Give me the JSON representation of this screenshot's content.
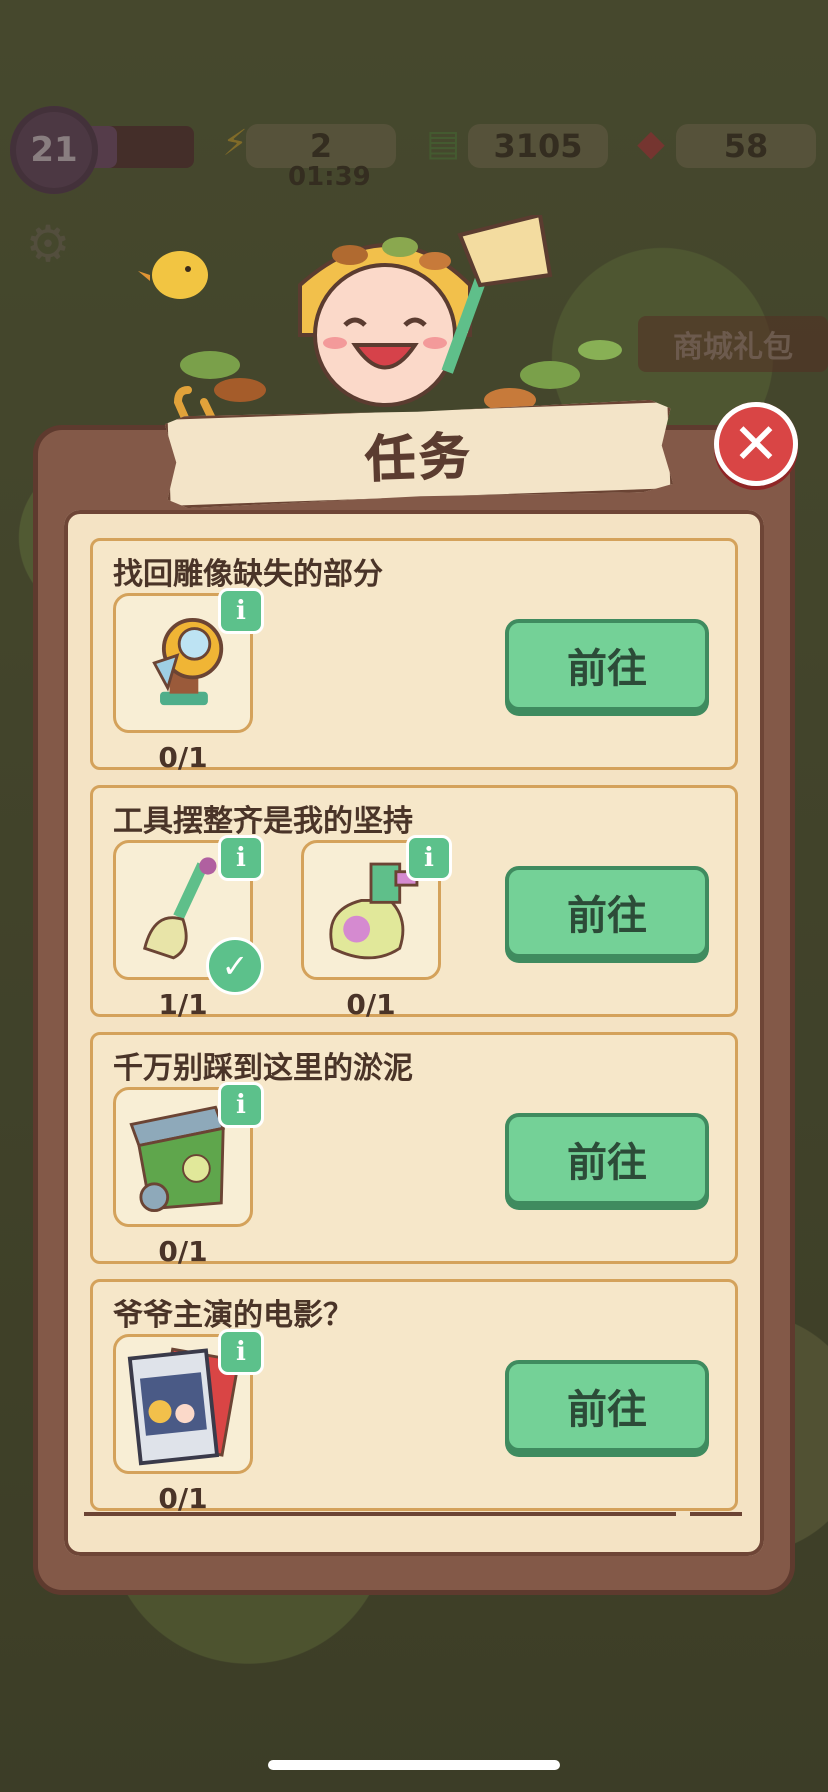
{
  "hud": {
    "level": "21",
    "level_progress": 0.3,
    "energy": "2",
    "energy_timer": "01:39",
    "cash": "3105",
    "gems": "58",
    "shop_label": "商城礼包"
  },
  "dialog": {
    "title": "任务",
    "tasks": [
      {
        "title": "找回雕像缺失的部分",
        "items": [
          {
            "icon": "statue-part-icon",
            "count": "0/1",
            "done": false
          }
        ],
        "button": "前往"
      },
      {
        "title": "工具摆整齐是我的坚持",
        "items": [
          {
            "icon": "broom-icon",
            "count": "1/1",
            "done": true
          },
          {
            "icon": "spray-bottle-icon",
            "count": "0/1",
            "done": false
          }
        ],
        "button": "前往"
      },
      {
        "title": "千万别踩到这里的淤泥",
        "items": [
          {
            "icon": "trash-bin-icon",
            "count": "0/1",
            "done": false
          }
        ],
        "button": "前往"
      },
      {
        "title": "爷爷主演的电影？",
        "items": [
          {
            "icon": "movie-poster-icon",
            "count": "0/1",
            "done": false
          }
        ],
        "button": "前往"
      }
    ]
  },
  "colors": {
    "panel": "#835948",
    "panel_inner": "#f4e3c4",
    "go_button": "#74d197",
    "close_button": "#d94545",
    "info_badge": "#5cc18b"
  }
}
